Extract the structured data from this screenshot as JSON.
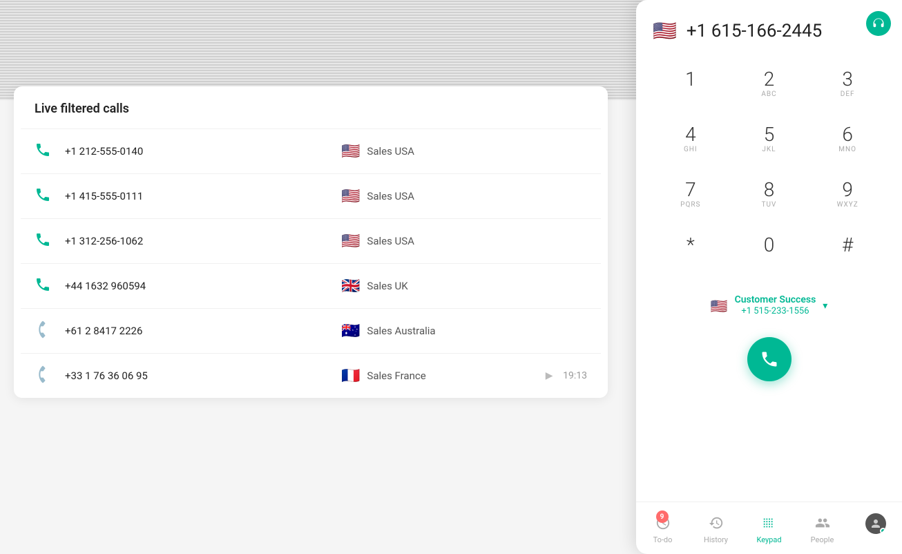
{
  "page": {
    "title": "Live filtered calls",
    "background_stripes": true
  },
  "dialer": {
    "phone_number": "+1 615-166-2445",
    "flag": "🇺🇸",
    "close_label": "×",
    "from": {
      "flag": "🇺🇸",
      "name": "Customer Success",
      "number": "+1 515-233-1556"
    },
    "keypad": [
      {
        "digit": "1",
        "letters": ""
      },
      {
        "digit": "2",
        "letters": "ABC"
      },
      {
        "digit": "3",
        "letters": "DEF"
      },
      {
        "digit": "4",
        "letters": "GHI"
      },
      {
        "digit": "5",
        "letters": "JKL"
      },
      {
        "digit": "6",
        "letters": "MNO"
      },
      {
        "digit": "7",
        "letters": "PQRS"
      },
      {
        "digit": "8",
        "letters": "TUV"
      },
      {
        "digit": "9",
        "letters": "WXYZ"
      },
      {
        "digit": "*",
        "letters": ""
      },
      {
        "digit": "0",
        "letters": ""
      },
      {
        "digit": "#",
        "letters": ""
      }
    ],
    "nav": [
      {
        "id": "todo",
        "label": "To-do",
        "badge": "9",
        "icon": "clock"
      },
      {
        "id": "history",
        "label": "History",
        "badge": "",
        "icon": "history"
      },
      {
        "id": "keypad",
        "label": "Keypad",
        "badge": "",
        "icon": "keypad",
        "active": true
      },
      {
        "id": "people",
        "label": "People",
        "badge": "",
        "icon": "people"
      },
      {
        "id": "avatar",
        "label": "",
        "badge": "",
        "icon": "avatar"
      }
    ]
  },
  "calls": [
    {
      "number": "+1 212-555-0140",
      "flag": "🇺🇸",
      "team": "Sales USA",
      "type": "inbound",
      "time": ""
    },
    {
      "number": "+1 415-555-0111",
      "flag": "🇺🇸",
      "team": "Sales USA",
      "type": "inbound",
      "time": ""
    },
    {
      "number": "+1 312-256-1062",
      "flag": "🇺🇸",
      "team": "Sales USA",
      "type": "inbound",
      "time": ""
    },
    {
      "number": "+44 1632 960594",
      "flag": "🇬🇧",
      "team": "Sales UK",
      "type": "inbound",
      "time": ""
    },
    {
      "number": "+61 2 8417 2226",
      "flag": "🇦🇺",
      "team": "Sales Australia",
      "type": "outbound",
      "time": ""
    },
    {
      "number": "+33 1 76 36 06 95",
      "flag": "🇫🇷",
      "team": "Sales France",
      "type": "outbound",
      "time": "19:13"
    }
  ]
}
